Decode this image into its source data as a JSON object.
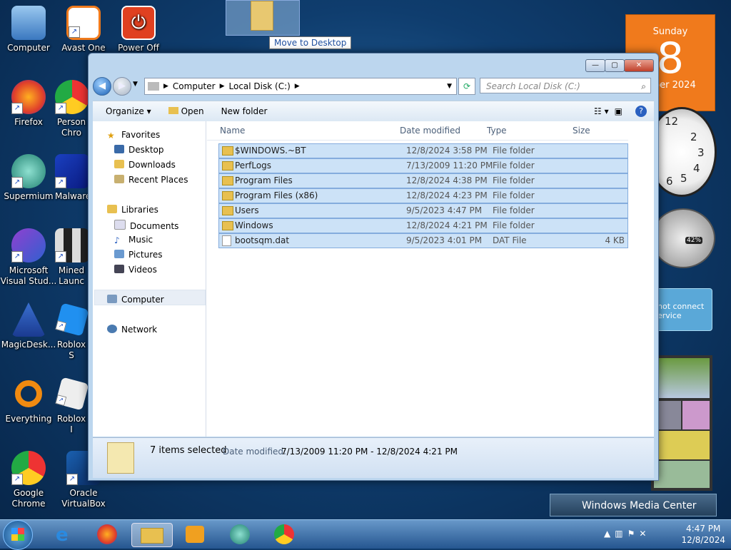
{
  "desktop": {
    "icons": [
      {
        "label": "Computer"
      },
      {
        "label": "Avast One"
      },
      {
        "label": "Power Off"
      },
      {
        "label": "Firefox"
      },
      {
        "label": "Person Chro"
      },
      {
        "label": "Supermium"
      },
      {
        "label": "Malware"
      },
      {
        "label": "Microsoft Visual Stud..."
      },
      {
        "label": "Mined Launc"
      },
      {
        "label": "MagicDesk..."
      },
      {
        "label": "Roblox S"
      },
      {
        "label": "Everything"
      },
      {
        "label": "Roblox I"
      },
      {
        "label": "Google Chrome"
      },
      {
        "label": "Oracle VirtualBox"
      }
    ],
    "drag_tooltip": "Move to Desktop"
  },
  "gadgets": {
    "calendar": {
      "weekday": "Sunday",
      "day": "8",
      "month": "mber 2024"
    },
    "clock_numbers": [
      "12",
      "2",
      "3",
      "4",
      "5",
      "6"
    ],
    "meter_percent": "42%",
    "weather_text": "not connect ervice",
    "media_center": "Windows Media Center"
  },
  "window": {
    "controls": {
      "minimize": "—",
      "maximize": "▢",
      "close": "✕"
    },
    "address": {
      "root": "Computer",
      "drive": "Local Disk (C:)"
    },
    "search_placeholder": "Search Local Disk (C:)",
    "toolbar": {
      "organize": "Organize ▾",
      "open": "Open",
      "new_folder": "New folder"
    },
    "nav": {
      "favorites": "Favorites",
      "desktop": "Desktop",
      "downloads": "Downloads",
      "recent": "Recent Places",
      "libraries": "Libraries",
      "documents": "Documents",
      "music": "Music",
      "pictures": "Pictures",
      "videos": "Videos",
      "computer": "Computer",
      "network": "Network"
    },
    "columns": {
      "name": "Name",
      "date": "Date modified",
      "type": "Type",
      "size": "Size"
    },
    "files": [
      {
        "name": "$WINDOWS.~BT",
        "date": "12/8/2024 3:58 PM",
        "type": "File folder",
        "size": ""
      },
      {
        "name": "PerfLogs",
        "date": "7/13/2009 11:20 PM",
        "type": "File folder",
        "size": ""
      },
      {
        "name": "Program Files",
        "date": "12/8/2024 4:38 PM",
        "type": "File folder",
        "size": ""
      },
      {
        "name": "Program Files (x86)",
        "date": "12/8/2024 4:23 PM",
        "type": "File folder",
        "size": ""
      },
      {
        "name": "Users",
        "date": "9/5/2023 4:47 PM",
        "type": "File folder",
        "size": ""
      },
      {
        "name": "Windows",
        "date": "12/8/2024 4:21 PM",
        "type": "File folder",
        "size": ""
      },
      {
        "name": "bootsqm.dat",
        "date": "9/5/2023 4:01 PM",
        "type": "DAT File",
        "size": "4 KB"
      }
    ],
    "status": {
      "selected": "7 items selected",
      "date_label": "Date modified:",
      "date_range": "7/13/2009 11:20 PM - 12/8/2024 4:21 PM"
    }
  },
  "taskbar": {
    "time": "4:47 PM",
    "date": "12/8/2024"
  },
  "colors": {
    "selection": "#cce2f7",
    "selection_border": "#84acdd",
    "calendar": "#f07a1c"
  }
}
